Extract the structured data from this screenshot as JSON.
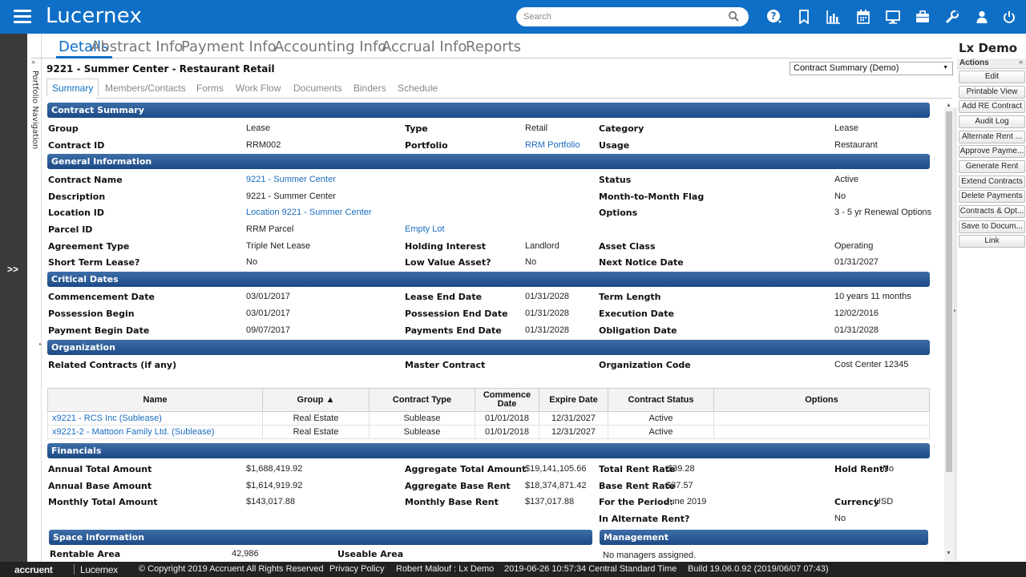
{
  "app": {
    "name": "Lucernex"
  },
  "search": {
    "placeholder": "Search"
  },
  "main_tabs": [
    "Details",
    "Abstract Info",
    "Payment Info",
    "Accounting Info",
    "Accrual Info",
    "Reports"
  ],
  "page_title": "9221 - Summer Center - Restaurant Retail",
  "report_select": "Contract Summary (Demo)",
  "sub_tabs": [
    "Summary",
    "Members/Contacts",
    "Forms",
    "Work Flow",
    "Documents",
    "Binders",
    "Schedule"
  ],
  "left_nav": {
    "expand": ">>",
    "portfolio_navigation": "Portfolio Navigation",
    "collapse": "»"
  },
  "right_panel": {
    "title": "Lx Demo",
    "actions_label": "Actions",
    "collapse": "»",
    "buttons": [
      "Edit",
      "Printable View",
      "Add RE Contract",
      "Audit Log",
      "Alternate Rent ...",
      "Approve Payme...",
      "Generate Rent",
      "Extend Contracts",
      "Delete Payments",
      "Contracts & Opt...",
      "Save to Docum...",
      "Link"
    ]
  },
  "sections": {
    "contract_summary": "Contract Summary",
    "general_information": "General Information",
    "critical_dates": "Critical Dates",
    "organization": "Organization",
    "financials": "Financials",
    "space_information": "Space Information",
    "management": "Management"
  },
  "contract_summary": {
    "group_label": "Group",
    "group": "Lease",
    "type_label": "Type",
    "type": "Retail",
    "category_label": "Category",
    "category": "Lease",
    "contract_id_label": "Contract ID",
    "contract_id": "RRM002",
    "portfolio_label": "Portfolio",
    "portfolio": "RRM Portfolio",
    "usage_label": "Usage",
    "usage": "Restaurant"
  },
  "general": {
    "contract_name_label": "Contract Name",
    "contract_name": "9221 - Summer Center",
    "status_label": "Status",
    "status": "Active",
    "description_label": "Description",
    "description": "9221 - Summer Center",
    "mtm_label": "Month-to-Month Flag",
    "mtm": "No",
    "location_id_label": "Location ID",
    "location_id": "Location 9221 - Summer Center",
    "options_label": "Options",
    "options": "3 - 5 yr Renewal Options",
    "parcel_id_label": "Parcel ID",
    "parcel_id": "RRM Parcel",
    "parcel_link": "Empty Lot",
    "agreement_type_label": "Agreement Type",
    "agreement_type": "Triple Net Lease",
    "holding_interest_label": "Holding Interest",
    "holding_interest": "Landlord",
    "asset_class_label": "Asset Class",
    "asset_class": "Operating",
    "short_term_label": "Short Term Lease?",
    "short_term": "No",
    "low_value_label": "Low Value Asset?",
    "low_value": "No",
    "next_notice_label": "Next Notice Date",
    "next_notice": "01/31/2027"
  },
  "critical_dates": {
    "commencement_label": "Commencement Date",
    "commencement": "03/01/2017",
    "lease_end_label": "Lease End Date",
    "lease_end": "01/31/2028",
    "term_length_label": "Term Length",
    "term_length": "10 years 11 months",
    "possession_begin_label": "Possession Begin",
    "possession_begin": "03/01/2017",
    "possession_end_label": "Possession End Date",
    "possession_end": "01/31/2028",
    "execution_label": "Execution Date",
    "execution": "12/02/2016",
    "payment_begin_label": "Payment Begin Date",
    "payment_begin": "09/07/2017",
    "payments_end_label": "Payments End Date",
    "payments_end": "01/31/2028",
    "obligation_label": "Obligation Date",
    "obligation": "01/31/2028"
  },
  "organization": {
    "related_label": "Related Contracts (if any)",
    "master_label": "Master Contract",
    "org_code_label": "Organization Code",
    "org_code": "Cost Center 12345"
  },
  "related_table": {
    "headers": [
      "Name",
      "Group ▲",
      "Contract Type",
      "Commence Date",
      "Expire Date",
      "Contract Status",
      "Options"
    ],
    "rows": [
      [
        "x9221 - RCS Inc (Sublease)",
        "Real Estate",
        "Sublease",
        "01/01/2018",
        "12/31/2027",
        "Active",
        ""
      ],
      [
        "x9221-2 - Mattoon Family Ltd. (Sublease)",
        "Real Estate",
        "Sublease",
        "01/01/2018",
        "12/31/2027",
        "Active",
        ""
      ]
    ]
  },
  "financials": {
    "annual_total_label": "Annual Total Amount",
    "annual_total": "$1,688,419.92",
    "agg_total_label": "Aggregate Total Amount",
    "agg_total": "$19,141,105.66",
    "total_rent_rate_label": "Total Rent Rate",
    "total_rent_rate": "$39.28",
    "hold_rent_label": "Hold Rent?",
    "hold_rent": "No",
    "annual_base_label": "Annual Base Amount",
    "annual_base": "$1,614,919.92",
    "agg_base_label": "Aggregate Base Rent",
    "agg_base": "$18,374,871.42",
    "base_rent_rate_label": "Base Rent Rate",
    "base_rent_rate": "$37.57",
    "monthly_total_label": "Monthly Total Amount",
    "monthly_total": "$143,017.88",
    "monthly_base_label": "Monthly Base Rent",
    "monthly_base": "$137,017.88",
    "period_label": "For the Period:",
    "period": "June 2019",
    "currency_label": "Currency",
    "currency": "USD",
    "alt_rent_label": "In Alternate Rent?",
    "alt_rent": "No"
  },
  "space": {
    "rentable_label": "Rentable Area",
    "rentable": "42,986",
    "useable_label": "Useable Area",
    "no_managers": "No managers assigned."
  },
  "footer": {
    "brand1": "accruent",
    "brand2": "Lucernex",
    "copyright": "© Copyright 2019 Accruent All Rights Reserved",
    "privacy": "Privacy Policy",
    "user": "Robert Malouf : Lx Demo",
    "datetime": "2019-06-26 10:57:34 Central Standard Time",
    "build": "Build 19.06.0.92 (2019/06/07 07:43)"
  }
}
